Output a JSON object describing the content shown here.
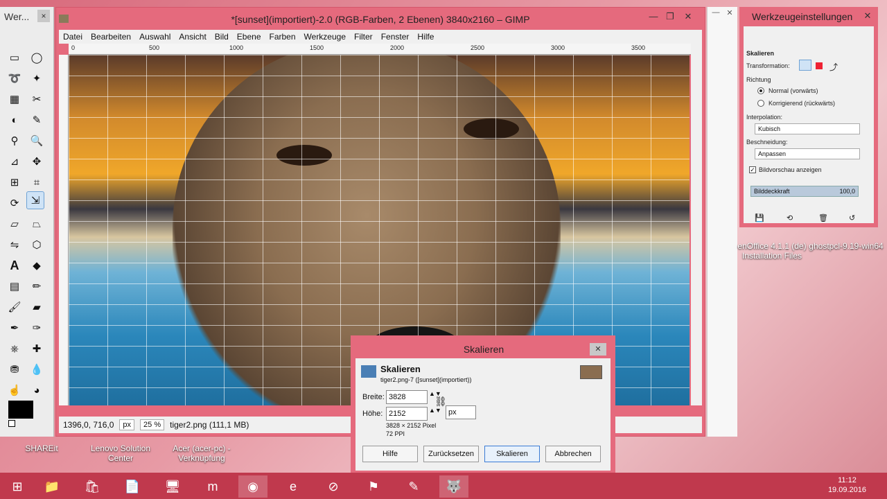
{
  "toolbox": {
    "title": "Wer...",
    "close": "×"
  },
  "gimp": {
    "title": "*[sunset](importiert)-2.0 (RGB-Farben, 2 Ebenen) 3840x2160 – GIMP",
    "menu": [
      "Datei",
      "Bearbeiten",
      "Auswahl",
      "Ansicht",
      "Bild",
      "Ebene",
      "Farben",
      "Werkzeuge",
      "Filter",
      "Fenster",
      "Hilfe"
    ],
    "ruler_labels": [
      "0",
      "500",
      "1000",
      "1500",
      "2000",
      "2500",
      "3000",
      "3500"
    ],
    "status": {
      "coords": "1396,0, 716,0",
      "unit": "px",
      "zoom": "25 %",
      "file": "tiger2.png (111,1 MB)"
    }
  },
  "dock": {
    "title": "Werkzeugeinstellungen",
    "tool_name": "Skalieren",
    "transformation_label": "Transformation:",
    "direction_label": "Richtung",
    "direction_normal": "Normal (vorwärts)",
    "direction_corrective": "Korrigierend (rückwärts)",
    "interpolation_label": "Interpolation:",
    "interpolation_value": "Kubisch",
    "clipping_label": "Beschneidung:",
    "clipping_value": "Anpassen",
    "preview_label": "Bildvorschau anzeigen",
    "opacity_label": "Bilddeckkraft",
    "opacity_value": "100,0"
  },
  "desktop": {
    "openoffice": "enOffice 4.1.1 (de)\nInstallation Files",
    "ghostpcl": "ghostpcl-9.19-win64",
    "shareit": "SHAREit",
    "lenovo": "Lenovo Solution Center",
    "acer": "Acer (acer-pc) - Verknüpfung"
  },
  "dialog": {
    "title": "Skalieren",
    "heading": "Skalieren",
    "subtitle": "tiger2.png-7 ([sunset](importiert))",
    "width_label": "Breite:",
    "width_value": "3828",
    "height_label": "Höhe:",
    "height_value": "2152",
    "unit": "px",
    "size_info": "3828 × 2152 Pixel",
    "ppi_info": "72 PPI",
    "btn_help": "Hilfe",
    "btn_reset": "Zurücksetzen",
    "btn_scale": "Skalieren",
    "btn_cancel": "Abbrechen"
  },
  "taskbar": {
    "time": "11:12",
    "date": "19.09.2016"
  }
}
